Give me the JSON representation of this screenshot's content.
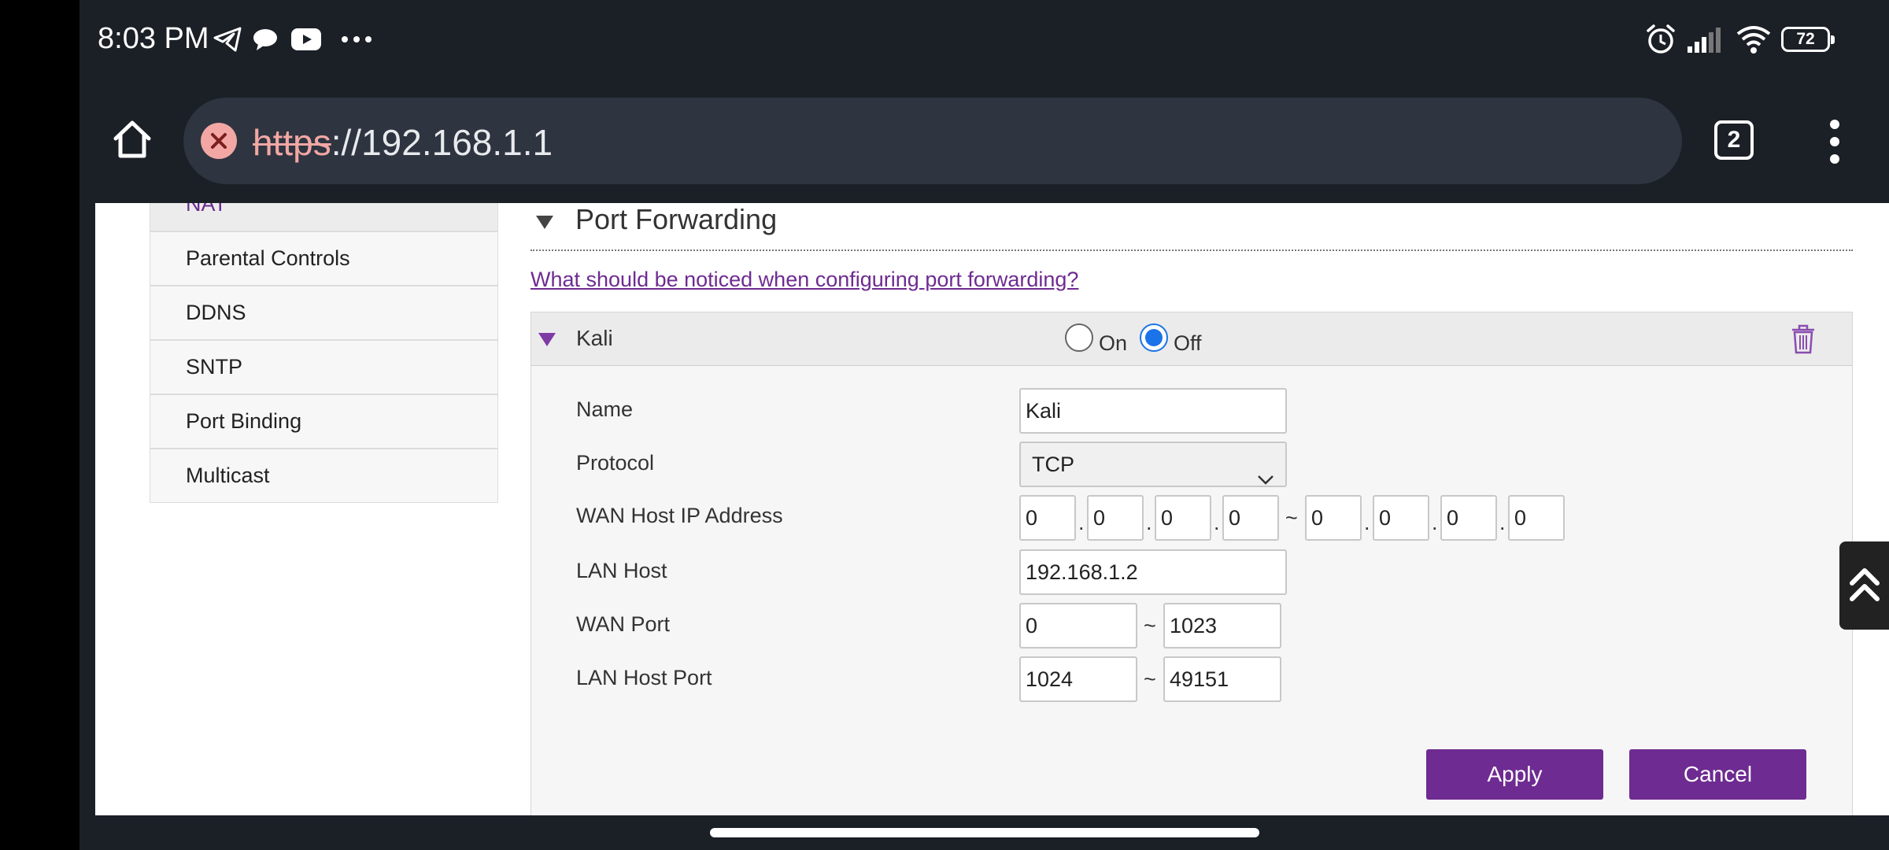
{
  "status_bar": {
    "time": "8:03 PM",
    "battery": "72",
    "icons": [
      "telegram-icon",
      "chat-bubble-icon",
      "youtube-icon",
      "more-dots-icon",
      "alarm-icon",
      "signal-icon",
      "wifi-icon",
      "battery-icon"
    ]
  },
  "browser": {
    "url_scheme": "https",
    "url_rest": "://192.168.1.1",
    "tab_count": "2"
  },
  "sidebar": {
    "items": [
      {
        "label": "NAT",
        "active": true
      },
      {
        "label": "Parental Controls"
      },
      {
        "label": "DDNS"
      },
      {
        "label": "SNTP"
      },
      {
        "label": "Port Binding"
      },
      {
        "label": "Multicast"
      }
    ]
  },
  "section": {
    "title": "Port Forwarding",
    "help_link": "What should be noticed when configuring port forwarding?"
  },
  "rule": {
    "name": "Kali",
    "on_label": "On",
    "off_label": "Off",
    "selected": "Off",
    "fields": {
      "name_label": "Name",
      "name_value": "Kali",
      "protocol_label": "Protocol",
      "protocol_value": "TCP",
      "wan_ip_label": "WAN Host IP Address",
      "wan_ip_start": [
        "0",
        "0",
        "0",
        "0"
      ],
      "wan_ip_end": [
        "0",
        "0",
        "0",
        "0"
      ],
      "lan_host_label": "LAN Host",
      "lan_host_value": "192.168.1.2",
      "wan_port_label": "WAN Port",
      "wan_port_start": "0",
      "wan_port_end": "1023",
      "lan_port_label": "LAN Host Port",
      "lan_port_start": "1024",
      "lan_port_end": "49151"
    },
    "separator_dot": ".",
    "range_tilde": "~"
  },
  "buttons": {
    "apply": "Apply",
    "cancel": "Cancel"
  },
  "colors": {
    "accent": "#6e2b91",
    "radio": "#1a73e8",
    "chrome": "#1b1f26"
  }
}
